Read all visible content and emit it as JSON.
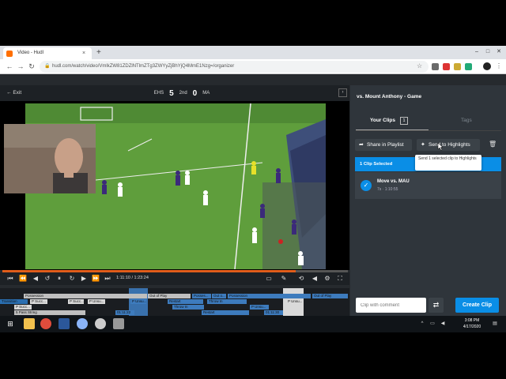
{
  "browser": {
    "tab_title": "Video - Hudl",
    "tab_close": "×",
    "new_tab": "+",
    "url": "hudl.com/watch/video/VmlkZW81ZDZlNTlmZTg3ZWYyZjBhYjQ4MmE1Nzg=/organizer",
    "window_controls": [
      "–",
      "□",
      "✕"
    ]
  },
  "video": {
    "exit_label": "Exit",
    "home_team": "EHS",
    "home_score": "5",
    "period": "2nd",
    "away_score": "0",
    "away_team": "MA",
    "time": "1:11:10 / 1:23:24",
    "progress": 0.85
  },
  "timeline": {
    "rows": [
      [
        {
          "label": "Possession",
          "color": "#bfbfbf"
        },
        {
          "label": "Out of Play",
          "color": "#bfbfbf"
        },
        {
          "label": "Posses...",
          "color": "#3d7bbd"
        },
        {
          "label": "Out o...",
          "color": "#3d7bbd"
        },
        {
          "label": "Possession",
          "color": "#3d7bbd"
        },
        {
          "label": "Out of Play",
          "color": "#3d7bbd"
        }
      ],
      [
        {
          "label": "Transition",
          "color": "#2a6eb0"
        },
        {
          "label": "P Succ...",
          "color": "#d9d9d9"
        },
        {
          "label": "P Succ...",
          "color": "#d9d9d9"
        },
        {
          "label": "P Unsu...",
          "color": "#d9d9d9"
        },
        {
          "label": "P Unsu...",
          "color": "#3d7bbd"
        },
        {
          "label": "Restart",
          "color": "#3d7bbd"
        },
        {
          "label": "Throw In",
          "color": "#3d7bbd"
        },
        {
          "label": "P Unsu...",
          "color": "#d9d9d9"
        }
      ],
      [
        {
          "label": "P Succ...",
          "color": "#d9d9d9"
        },
        {
          "label": "Throw In",
          "color": "#3d7bbd"
        },
        {
          "label": "P Unsu...",
          "color": "#3d7bbd"
        }
      ],
      [
        {
          "label": "5 Pass String",
          "color": "#bfbfbf"
        },
        {
          "label": "01:11:22",
          "color": "#3d7bbd"
        },
        {
          "label": "Restart",
          "color": "#3d7bbd"
        },
        {
          "label": "01:11:30",
          "color": "#3d7bbd"
        }
      ]
    ]
  },
  "panel": {
    "game_title": "vs. Mount Anthony - Game",
    "tab_clips": "Your Clips",
    "clip_count": "1",
    "tab_tags": "Tags",
    "share_label": "Share in Playlist",
    "send_label": "Send to Highlights",
    "selected_label": "1 Clip Selected",
    "tooltip": "Send 1 selected clip to Highlights",
    "clip": {
      "title": "Move vs. MAU",
      "meta": "7s · 1:10:55"
    },
    "comment_placeholder": "Clip with comment",
    "create_label": "Create Clip"
  },
  "taskbar": {
    "time": "3:08 PM",
    "date": "4/17/2020"
  },
  "colors": {
    "accent": "#0a8ee6",
    "progress": "#e05d1a",
    "panel_bg": "#2f353b",
    "field": "#5f9e3c"
  }
}
